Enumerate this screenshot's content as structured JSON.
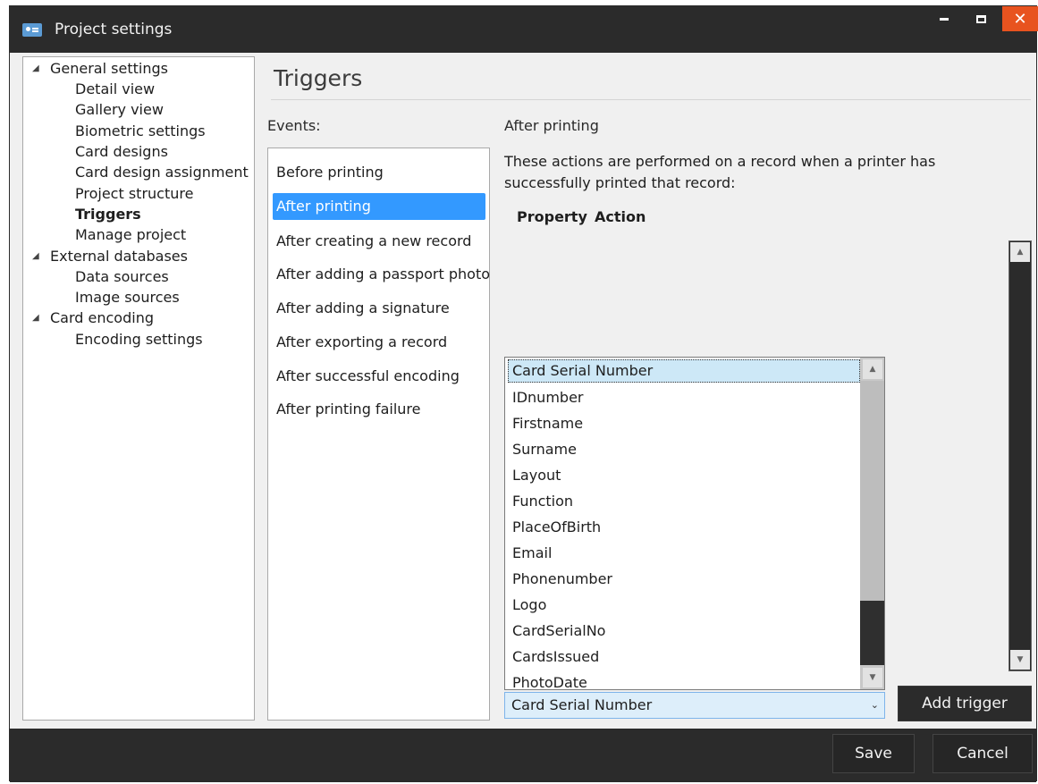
{
  "window": {
    "title": "Project settings",
    "minimize_label": "",
    "maximize_label": "",
    "close_glyph": "✕"
  },
  "nav": {
    "groups": [
      {
        "label": "General settings",
        "items": [
          "Detail view",
          "Gallery view",
          "Biometric settings",
          "Card designs",
          "Card design assignment",
          "Project structure",
          "Triggers",
          "Manage project"
        ]
      },
      {
        "label": "External databases",
        "items": [
          "Data sources",
          "Image sources"
        ]
      },
      {
        "label": "Card encoding",
        "items": [
          "Encoding settings"
        ]
      }
    ],
    "selected": "Triggers",
    "expander_glyph": "◢"
  },
  "page": {
    "title": "Triggers",
    "events_label": "Events:",
    "events": [
      "Before printing",
      "After printing",
      "After creating a new record",
      "After adding a passport photo",
      "After adding a signature",
      "After exporting a record",
      "After successful encoding",
      "After printing failure"
    ],
    "selected_event": "After printing",
    "detail": {
      "heading": "After printing",
      "description": "These actions are performed on a record when a printer has successfully printed that record:",
      "columns": [
        "Property",
        "Action"
      ]
    }
  },
  "dropdown": {
    "selected": "Card Serial Number",
    "options": [
      "IDnumber",
      "Firstname",
      "Surname",
      "Layout",
      "Function",
      "PlaceOfBirth",
      "Email",
      "Phonenumber",
      "Logo",
      "CardSerialNo",
      "CardsIssued",
      "PhotoDate"
    ],
    "combo_value": "Card Serial Number",
    "combo_arrow": "⌄",
    "scroll_up": "▲",
    "scroll_down": "▼"
  },
  "buttons": {
    "add_trigger": "Add trigger",
    "save": "Save",
    "cancel": "Cancel"
  },
  "colors": {
    "titlebar": "#2b2b2b",
    "close_button": "#e8531f",
    "selection": "#3399ff",
    "dropdown_highlight": "#cde8f7"
  }
}
